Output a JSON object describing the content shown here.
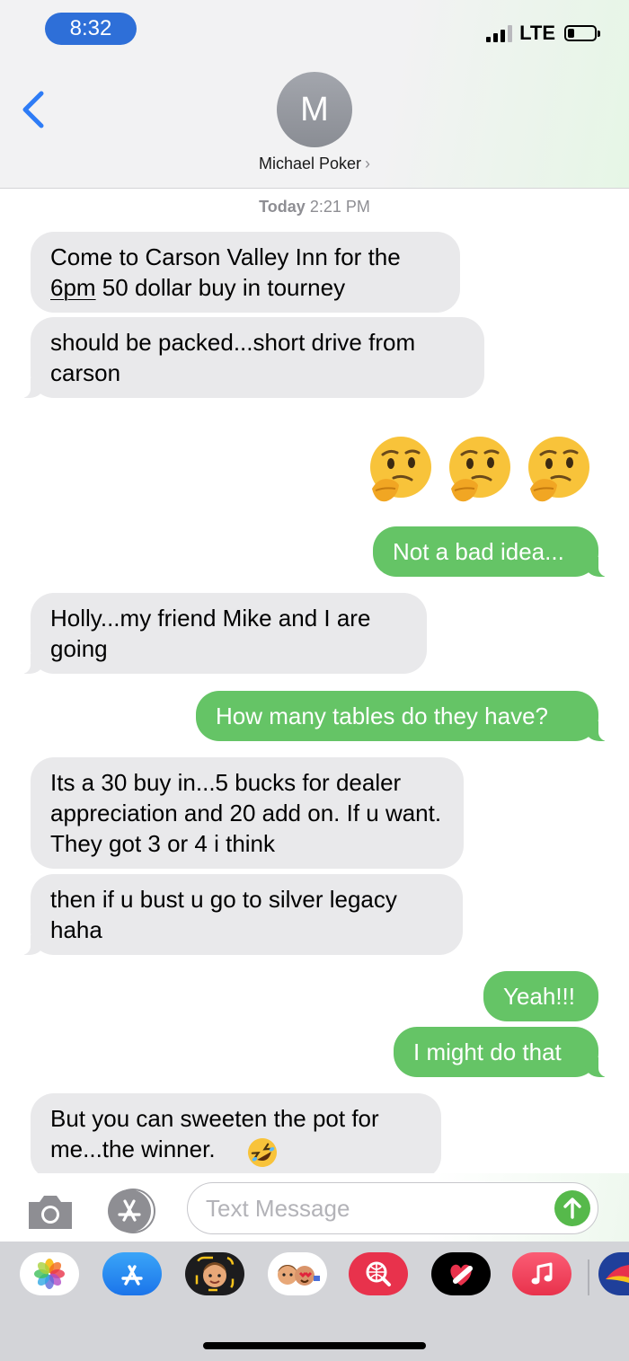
{
  "status_bar": {
    "time": "8:32",
    "network": "LTE",
    "battery_level": 0.25
  },
  "header": {
    "avatar_initial": "M",
    "contact_name": "Michael Poker",
    "contact_chevron": "›"
  },
  "conversation": {
    "timestamp_day": "Today",
    "timestamp_time": "2:21 PM",
    "messages": [
      {
        "direction": "incoming",
        "line1_prefix": "Come to Carson Valley Inn for the",
        "line2_link": "6pm",
        "line2_rest": " 50 dollar buy in tourney"
      },
      {
        "direction": "incoming",
        "text": "should be packed...short drive from carson"
      },
      {
        "direction": "outgoing",
        "emoji": [
          "thinking-face",
          "thinking-face",
          "thinking-face"
        ]
      },
      {
        "direction": "outgoing",
        "text": "Not a bad idea..."
      },
      {
        "direction": "incoming",
        "text": "Holly...my friend Mike and I are going"
      },
      {
        "direction": "outgoing",
        "text": "How many tables do they have?"
      },
      {
        "direction": "incoming",
        "text": "Its a 30 buy in...5 bucks for dealer appreciation and 20 add on.  If u want.  They got 3 or 4 i think"
      },
      {
        "direction": "incoming",
        "text": "then if u bust u go to silver legacy haha"
      },
      {
        "direction": "outgoing",
        "text": "Yeah!!!"
      },
      {
        "direction": "outgoing",
        "text": "I might do that"
      },
      {
        "direction": "incoming",
        "text": "But you can sweeten the pot for me...the winner.",
        "emoji": "rolling-on-floor-laughing"
      }
    ]
  },
  "composer": {
    "placeholder": "Text Message"
  },
  "app_drawer": {
    "apps": [
      "photos",
      "app-store",
      "memoji",
      "animoji-stickers",
      "web-images",
      "digital-touch",
      "music",
      "partial-app"
    ]
  },
  "colors": {
    "incoming_bubble": "#e9e9eb",
    "outgoing_bubble": "#65c466",
    "accent_blue": "#2e7cf6",
    "time_pill": "#2e6fd8"
  }
}
